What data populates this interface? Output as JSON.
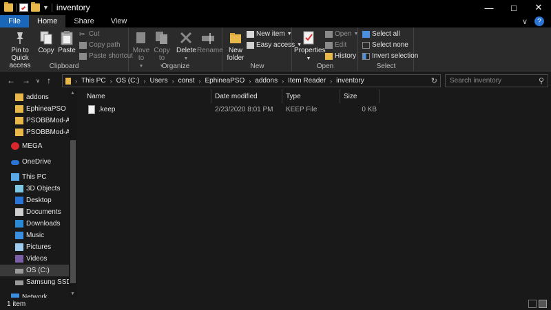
{
  "window": {
    "title": "inventory"
  },
  "tabs": [
    "File",
    "Home",
    "Share",
    "View"
  ],
  "ribbon": {
    "clipboard": {
      "label": "Clipboard",
      "pin": "Pin to Quick access",
      "copy": "Copy",
      "paste": "Paste",
      "cut": "Cut",
      "copy_path": "Copy path",
      "paste_shortcut": "Paste shortcut"
    },
    "organize": {
      "label": "Organize",
      "move_to": "Move to",
      "copy_to": "Copy to",
      "delete": "Delete",
      "rename": "Rename"
    },
    "new": {
      "label": "New",
      "new_folder": "New folder",
      "new_item": "New item",
      "easy_access": "Easy access"
    },
    "open": {
      "label": "Open",
      "properties": "Properties",
      "open": "Open",
      "edit": "Edit",
      "history": "History"
    },
    "select": {
      "label": "Select",
      "select_all": "Select all",
      "select_none": "Select none",
      "invert": "Invert selection"
    }
  },
  "address": {
    "crumbs": [
      "This PC",
      "OS (C:)",
      "Users",
      "const",
      "EphineaPSO",
      "addons",
      "Item Reader",
      "inventory"
    ],
    "search_placeholder": "Search inventory"
  },
  "nav": {
    "items": [
      {
        "label": "addons",
        "icon": "folder-icon",
        "indent": 1
      },
      {
        "label": "EphineaPSO",
        "icon": "folder-icon",
        "indent": 1
      },
      {
        "label": "PSOBBMod-Adc",
        "icon": "folder-icon",
        "indent": 1
      },
      {
        "label": "PSOBBMod-Adc",
        "icon": "folder-icon",
        "indent": 1
      },
      {
        "label": "MEGA",
        "icon": "mega-icon",
        "indent": 0
      },
      {
        "label": "OneDrive",
        "icon": "onedrive-icon",
        "indent": 0
      },
      {
        "label": "This PC",
        "icon": "pc-icon",
        "indent": 0
      },
      {
        "label": "3D Objects",
        "icon": "cube-icon",
        "indent": 1
      },
      {
        "label": "Desktop",
        "icon": "desktop-icon",
        "indent": 1
      },
      {
        "label": "Documents",
        "icon": "documents-icon",
        "indent": 1
      },
      {
        "label": "Downloads",
        "icon": "downloads-icon",
        "indent": 1
      },
      {
        "label": "Music",
        "icon": "music-icon",
        "indent": 1
      },
      {
        "label": "Pictures",
        "icon": "pictures-icon",
        "indent": 1
      },
      {
        "label": "Videos",
        "icon": "videos-icon",
        "indent": 1
      },
      {
        "label": "OS (C:)",
        "icon": "drive-icon",
        "indent": 1
      },
      {
        "label": "Samsung SSD (D",
        "icon": "drive-icon",
        "indent": 1
      },
      {
        "label": "Network",
        "icon": "network-icon",
        "indent": 0
      }
    ]
  },
  "columns": [
    "Name",
    "Date modified",
    "Type",
    "Size"
  ],
  "files": [
    {
      "name": ".keep",
      "date": "2/23/2020 8:01 PM",
      "type": "KEEP File",
      "size": "0 KB"
    }
  ],
  "status": {
    "count": "1 item"
  },
  "colors": {
    "accent": "#1a66b8",
    "background": "#191919",
    "ribbon": "#2b2b2b",
    "folder": "#e8b94a"
  }
}
